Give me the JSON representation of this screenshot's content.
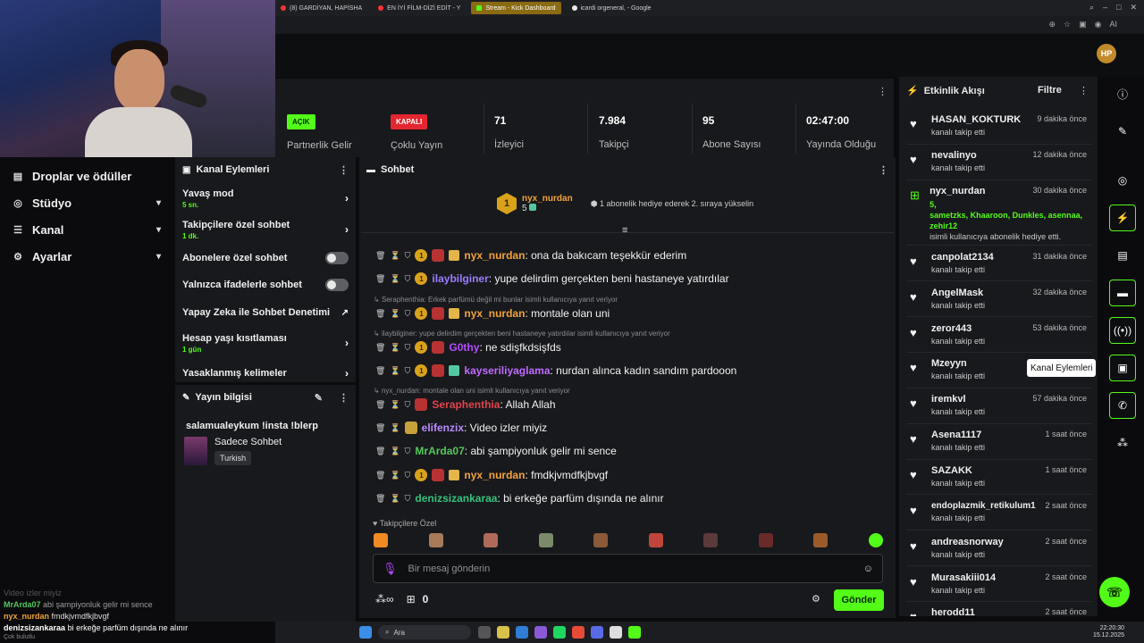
{
  "browser": {
    "tabs": [
      {
        "label": "(8) GARDİYAN, HAPİSHA",
        "color": "#ff3333"
      },
      {
        "label": "EN İYİ FİLM-DİZİ EDİT - Y",
        "color": "#ff3333"
      },
      {
        "label": "Stream - Kick Dashboard",
        "color": "#53fc18"
      },
      {
        "label": "icardi orgeneral, - Google",
        "color": "#e8e8e8"
      }
    ],
    "ai_label": "AI"
  },
  "leftnav": {
    "items": [
      {
        "label": "Droplar ve ödüller",
        "icon": "drops-icon",
        "chevron": ""
      },
      {
        "label": "Stüdyo",
        "icon": "studio-icon",
        "chevron": "⌄"
      },
      {
        "label": "Kanal",
        "icon": "channel-icon",
        "chevron": "⌄"
      },
      {
        "label": "Ayarlar",
        "icon": "gear-icon",
        "chevron": "⌄"
      }
    ]
  },
  "stats": {
    "partner": {
      "badge": "AÇIK",
      "label": "Partnerlik Gelir"
    },
    "multi": {
      "badge": "KAPALI",
      "label": "Çoklu Yayın"
    },
    "viewers": {
      "value": "71",
      "label": "İzleyici"
    },
    "followers": {
      "value": "7.984",
      "label": "Takipçi"
    },
    "subs": {
      "value": "95",
      "label": "Abone Sayısı"
    },
    "uptime": {
      "value": "02:47:00",
      "label": "Yayında Olduğu"
    },
    "colors": {
      "on": "#53fc18",
      "off": "#e3262f"
    }
  },
  "channel_actions": {
    "title": "Kanal Eylemleri",
    "items": [
      {
        "label": "Yavaş mod",
        "sub": "5 sn."
      },
      {
        "label": "Takipçilere özel sohbet",
        "sub": "1 dk."
      },
      {
        "label": "Abonelere özel sohbet"
      },
      {
        "label": "Yalnızca ifadelerle sohbet"
      },
      {
        "label": "Yapay Zeka ile Sohbet Denetimi"
      },
      {
        "label": "Hesap yaşı kısıtlaması",
        "sub": "1 gün"
      },
      {
        "label": "Yasaklanmış kelimeler"
      }
    ]
  },
  "stream_info": {
    "title": "Yayın bilgisi",
    "stream_title": "salamualeykum !insta !blerp",
    "category": "Sadece Sohbet",
    "language": "Turkish"
  },
  "chat": {
    "title": "Sohbet",
    "pinned": {
      "user": "nyx_nurdan",
      "rank": "1",
      "count": "5",
      "text": "1 abonelik hediye ederek 2. sıraya yükselin"
    },
    "messages": [
      {
        "user": "nyx_nurdan",
        "color": "#f2a33a",
        "text": ": ona da bakıcam teşekkür ederim",
        "coin": "1"
      },
      {
        "user": "ilaybilginer",
        "color": "#9b7dff",
        "text": ": yupe delirdim gerçekten beni hastaneye yatırdılar",
        "coin": "1"
      },
      {
        "reply": "Seraphenthia: Erkek parfümü değil mi bunlar isimli kullanıcıya yanıt veriyor"
      },
      {
        "user": "nyx_nurdan",
        "color": "#f2a33a",
        "text": ": montale olan uni",
        "coin": "1"
      },
      {
        "reply": "ilaybilginer: yupe delirdim gerçekten beni hastaneye yatırdılar isimli kullanıcıya yanıt veriyor"
      },
      {
        "user": "G0thy",
        "color": "#b44dff",
        "text": ": ne sdişfkdsişfds",
        "coin": "1"
      },
      {
        "user": "kayseriliyaglama",
        "color": "#c06bff",
        "text": ": nurdan alınca kadın sandım pardooon",
        "coin": "1"
      },
      {
        "reply": "nyx_nurdan: montale olan uni isimli kullanıcıya yanıt veriyor"
      },
      {
        "user": "Seraphenthia",
        "color": "#e0434d",
        "text": ": Allah Allah"
      },
      {
        "user": "elifenzix",
        "color": "#b98cff",
        "text": ": Video izler miyiz"
      },
      {
        "user": "MrArda07",
        "color": "#53c75a",
        "text": ": abi şampiyonluk gelir mi sence"
      },
      {
        "user": "nyx_nurdan",
        "color": "#f2a33a",
        "text": ": fmdkjvmdfkjbvgf",
        "coin": "1"
      },
      {
        "user": "denizsizankaraa",
        "color": "#33c27a",
        "text": ": bi erkeğe parfüm dışında ne alınır"
      }
    ],
    "followers_only": "Takipçilere Özel",
    "input_placeholder": "Bir mesaj gönderin",
    "points": "0",
    "send": "Gönder"
  },
  "activity": {
    "title": "Etkinlik Akışı",
    "filter": "Filtre",
    "items": [
      {
        "name": "HASAN_KOKTURK",
        "desc": "kanalı takip etti",
        "time": "9 dakika önce"
      },
      {
        "name": "nevalinyo",
        "desc": "kanalı takip etti",
        "time": "12 dakika önce"
      },
      {
        "name": "nyx_nurdan",
        "count": "5,",
        "names": "sametzks, Khaaroon, Dunkles, asennaa, zehir12",
        "desc": "isimli kullanıcıya abonelik hediye etti.",
        "time": "30 dakika önce"
      },
      {
        "name": "canpolat2134",
        "desc": "kanalı takip etti",
        "time": "31 dakika önce"
      },
      {
        "name": "AngelMask",
        "desc": "kanalı takip etti",
        "time": "32 dakika önce"
      },
      {
        "name": "zeror443",
        "desc": "kanalı takip etti",
        "time": "53 dakika önce"
      },
      {
        "name": "Mzeyyn",
        "desc": "kanalı takip etti",
        "time": ""
      },
      {
        "name": "iremkvl",
        "desc": "kanalı takip etti",
        "time": "57 dakika önce"
      },
      {
        "name": "Asena1117",
        "desc": "kanalı takip etti",
        "time": "1 saat önce"
      },
      {
        "name": "SAZAKK",
        "desc": "kanalı takip etti",
        "time": "1 saat önce"
      },
      {
        "name": "endoplazmik_retikulum1",
        "desc": "kanalı takip etti",
        "time": "2 saat önce"
      },
      {
        "name": "andreasnorway",
        "desc": "kanalı takip etti",
        "time": "2 saat önce"
      },
      {
        "name": "Murasakiii014",
        "desc": "kanalı takip etti",
        "time": "2 saat önce"
      },
      {
        "name": "herodd11",
        "desc": "",
        "time": "2 saat önce"
      }
    ],
    "tooltip": "Kanal Eylemleri"
  },
  "overlay_chat": [
    {
      "user": "",
      "text": "Video izler miyiz"
    },
    {
      "user": "MrArda07",
      "text": "abi şampiyonluk gelir mi sence"
    },
    {
      "user": "nyx_nurdan",
      "text": "fmdkjvmdfkjbvgf"
    },
    {
      "user": "denizsizankaraa",
      "text": "bi erkeğe parfüm dışında ne alınır"
    }
  ],
  "overlay_footer": "Çok bulutlu",
  "taskbar": {
    "search": "Ara",
    "time": "22:20:30",
    "date": "15.12.2025"
  }
}
